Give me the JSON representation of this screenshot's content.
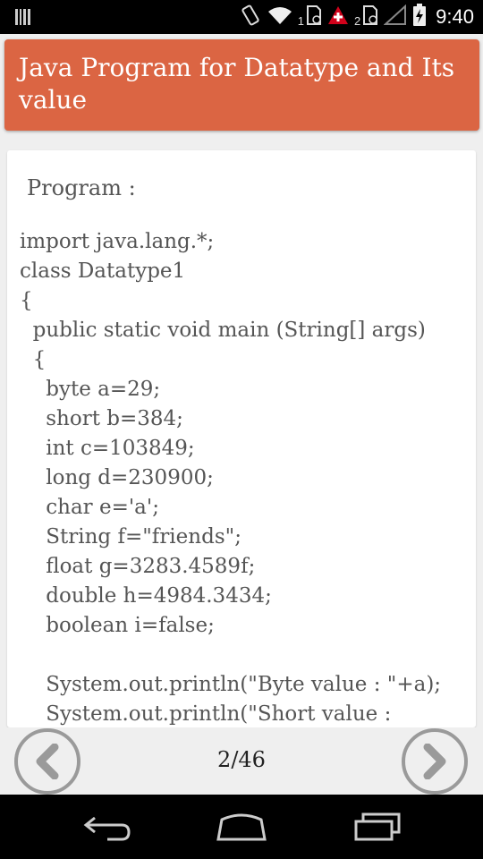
{
  "status_bar": {
    "time": "9:40",
    "sim1": "1",
    "sim2": "2",
    "icons": [
      "barcode-icon",
      "vibrate-icon",
      "wifi-icon",
      "sim-icon",
      "alert-icon",
      "sim-icon",
      "signal-icon",
      "battery-charging-icon"
    ]
  },
  "header": {
    "title": "Java Program for Datatype and Its value",
    "color": "#db6543"
  },
  "content": {
    "program_label": "Program :",
    "code_lines": [
      "import java.lang.*;",
      "class Datatype1",
      "{",
      "  public static void main (String[] args)",
      "  {",
      "    byte a=29;",
      "    short b=384;",
      "    int c=103849;",
      "    long d=230900;",
      "    char e='a';",
      "    String f=\"friends\";",
      "    float g=3283.4589f;",
      "    double h=4984.3434;",
      "    boolean i=false;",
      "",
      "    System.out.println(\"Byte value : \"+a);",
      "    System.out.println(\"Short value :"
    ]
  },
  "footer": {
    "page_indicator": "2/46",
    "prev_icon": "chevron-left-icon",
    "next_icon": "chevron-right-icon"
  },
  "navbar": {
    "back_icon": "back-icon",
    "home_icon": "home-icon",
    "recents_icon": "recents-icon"
  }
}
